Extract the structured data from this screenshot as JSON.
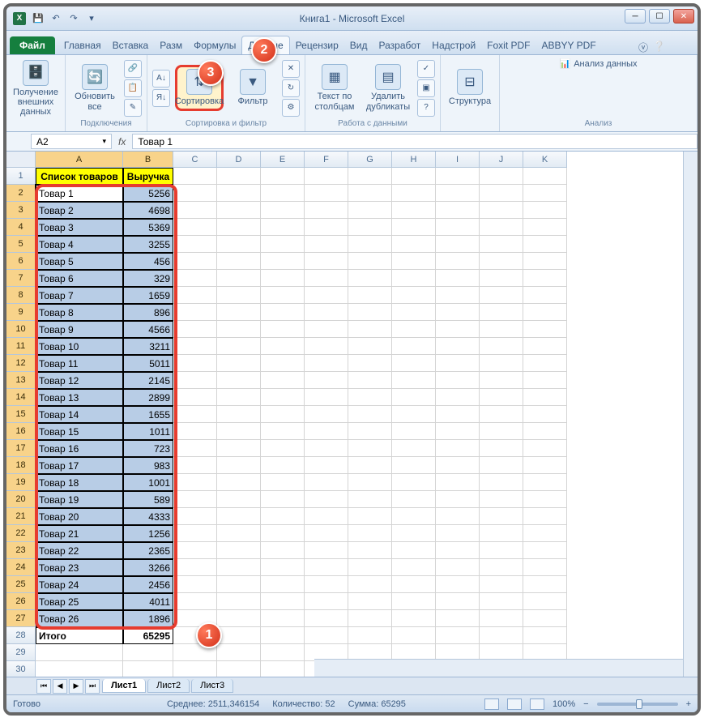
{
  "title": "Книга1  -  Microsoft Excel",
  "tabs": {
    "file": "Файл",
    "items": [
      "Главная",
      "Вставка",
      "Разм",
      "Формулы",
      "Данные",
      "Рецензир",
      "Вид",
      "Разработ",
      "Надстрой",
      "Foxit PDF",
      "ABBYY PDF"
    ],
    "active": "Данные"
  },
  "ribbon": {
    "g1": {
      "btn": "Получение\nвнешних данных"
    },
    "g2": {
      "btn": "Обновить\nвсе",
      "label": "Подключения"
    },
    "g3": {
      "sort": "Сортировка",
      "filter": "Фильтр",
      "label": "Сортировка и фильтр"
    },
    "g4": {
      "b1": "Текст по\nстолбцам",
      "b2": "Удалить\nдубликаты",
      "label": "Работа с данными"
    },
    "g5": {
      "btn": "Структура"
    },
    "g6": {
      "btn": "Анализ данных",
      "label": "Анализ"
    }
  },
  "namebox": "A2",
  "formula": "Товар 1",
  "columns": [
    "A",
    "B",
    "C",
    "D",
    "E",
    "F",
    "G",
    "H",
    "I",
    "J",
    "K"
  ],
  "headers": {
    "a": "Список товаров",
    "b": "Выручка"
  },
  "rows": [
    {
      "n": "1"
    },
    {
      "n": "2",
      "a": "Товар 1",
      "b": "5256"
    },
    {
      "n": "3",
      "a": "Товар 2",
      "b": "4698"
    },
    {
      "n": "4",
      "a": "Товар 3",
      "b": "5369"
    },
    {
      "n": "5",
      "a": "Товар 4",
      "b": "3255"
    },
    {
      "n": "6",
      "a": "Товар 5",
      "b": "456"
    },
    {
      "n": "7",
      "a": "Товар 6",
      "b": "329"
    },
    {
      "n": "8",
      "a": "Товар 7",
      "b": "1659"
    },
    {
      "n": "9",
      "a": "Товар 8",
      "b": "896"
    },
    {
      "n": "10",
      "a": "Товар 9",
      "b": "4566"
    },
    {
      "n": "11",
      "a": "Товар 10",
      "b": "3211"
    },
    {
      "n": "12",
      "a": "Товар 11",
      "b": "5011"
    },
    {
      "n": "13",
      "a": "Товар 12",
      "b": "2145"
    },
    {
      "n": "14",
      "a": "Товар 13",
      "b": "2899"
    },
    {
      "n": "15",
      "a": "Товар 14",
      "b": "1655"
    },
    {
      "n": "16",
      "a": "Товар 15",
      "b": "1011"
    },
    {
      "n": "17",
      "a": "Товар 16",
      "b": "723"
    },
    {
      "n": "18",
      "a": "Товар 17",
      "b": "983"
    },
    {
      "n": "19",
      "a": "Товар 18",
      "b": "1001"
    },
    {
      "n": "20",
      "a": "Товар 19",
      "b": "589"
    },
    {
      "n": "21",
      "a": "Товар 20",
      "b": "4333"
    },
    {
      "n": "22",
      "a": "Товар 21",
      "b": "1256"
    },
    {
      "n": "23",
      "a": "Товар 22",
      "b": "2365"
    },
    {
      "n": "24",
      "a": "Товар 23",
      "b": "3266"
    },
    {
      "n": "25",
      "a": "Товар 24",
      "b": "2456"
    },
    {
      "n": "26",
      "a": "Товар 25",
      "b": "4011"
    },
    {
      "n": "27",
      "a": "Товар 26",
      "b": "1896"
    }
  ],
  "total": {
    "n": "28",
    "a": "Итого",
    "b": "65295"
  },
  "blank": [
    "29",
    "30"
  ],
  "sheets": [
    "Лист1",
    "Лист2",
    "Лист3"
  ],
  "status": {
    "ready": "Готово",
    "avg_l": "Среднее:",
    "avg_v": "2511,346154",
    "cnt_l": "Количество:",
    "cnt_v": "52",
    "sum_l": "Сумма:",
    "sum_v": "65295",
    "zoom": "100%"
  },
  "badges": {
    "b1": "1",
    "b2": "2",
    "b3": "3"
  }
}
